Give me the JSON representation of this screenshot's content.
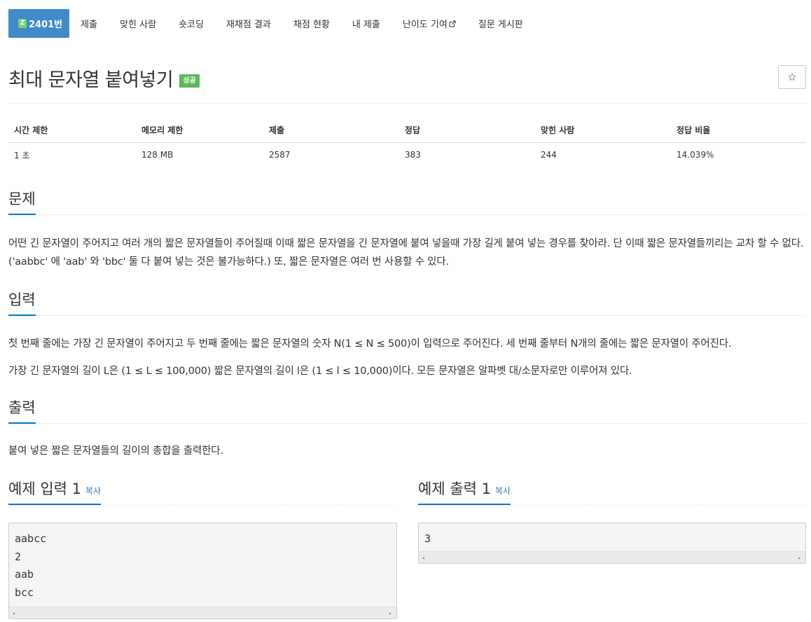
{
  "nav": {
    "active_badge": "Z",
    "active_label": "2401번",
    "items": [
      {
        "label": "제출"
      },
      {
        "label": "맞힌 사람"
      },
      {
        "label": "숏코딩"
      },
      {
        "label": "재채점 결과"
      },
      {
        "label": "채점 현황"
      },
      {
        "label": "내 제출"
      },
      {
        "label": "난이도 기여"
      },
      {
        "label": "질문 게시판"
      }
    ]
  },
  "problem": {
    "title": "최대 문자열 붙여넣기",
    "status": "성공",
    "star": "☆"
  },
  "info_table": {
    "headers": [
      "시간 제한",
      "메모리 제한",
      "제출",
      "정답",
      "맞힌 사람",
      "정답 비율"
    ],
    "values": [
      "1 초",
      "128 MB",
      "2587",
      "383",
      "244",
      "14.039%"
    ]
  },
  "sections": {
    "description": {
      "heading": "문제",
      "text": "어떤 긴 문자열이 주어지고 여러 개의 짧은 문자열들이 주어질때 이때 짧은 문자열을 긴 문자열에 붙여 넣을때 가장 길게 붙여 넣는 경우를 찾아라. 단 이때 짧은 문자열들끼리는 교차 할 수 없다. ('aabbc'  에  'aab' 와 'bbc' 둘 다 붙여 넣는 것은 불가능하다.) 또, 짧은 문자열은 여러 번 사용할 수 있다."
    },
    "input": {
      "heading": "입력",
      "line1": "첫 번째 줄에는 가장 긴 문자열이 주어지고 두 번째 줄에는 짧은 문자열의 숫자 N(1 ≤ N ≤ 500)이 입력으로 주어진다. 세 번째 줄부터 N개의 줄에는 짧은 문자열이 주어진다.",
      "line2": "가장 긴 문자열의 길이 L은 (1 ≤ L ≤ 100,000) 짧은 문자열의 길이 l은 (1 ≤ l ≤ 10,000)이다. 모든 문자열은 알파벳 대/소문자로만 이루어져 있다."
    },
    "output": {
      "heading": "출력",
      "text": "붙여 넣은 짧은 문자열들의 길이의 총합을 출력한다."
    }
  },
  "samples": {
    "input": {
      "heading": "예제 입력 1",
      "copy": "복사",
      "content": "aabcc\n2\naab\nbcc"
    },
    "output": {
      "heading": "예제 출력 1",
      "copy": "복사",
      "content": "3"
    },
    "scroll_left": "◂",
    "scroll_right": "▸"
  }
}
